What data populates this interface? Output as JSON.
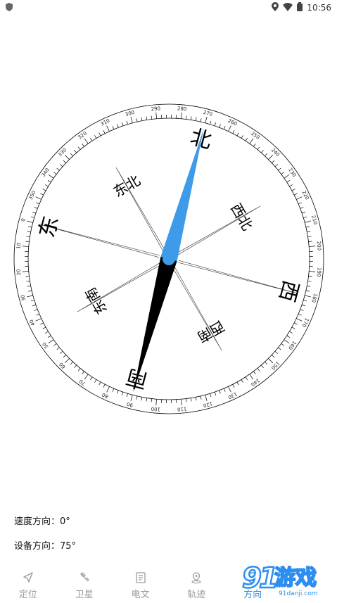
{
  "status_bar": {
    "time": "10:56",
    "icons": [
      "shield-icon",
      "location-icon",
      "wifi-icon",
      "battery-icon"
    ]
  },
  "compass": {
    "heading_degrees": 75,
    "labels": {
      "east": "东",
      "south": "南",
      "west": "西",
      "north": "北",
      "northeast": "东北",
      "southeast": "东南",
      "southwest": "西南",
      "northwest": "西北"
    },
    "needle_colors": {
      "north": "#3d9be9",
      "south": "#000000"
    }
  },
  "readouts": {
    "speed_direction": "速度方向：0°",
    "device_direction": "设备方向：75°"
  },
  "nav": {
    "items": [
      {
        "label": "定位",
        "icon": "navigation-arrow-icon",
        "active": false
      },
      {
        "label": "卫星",
        "icon": "satellite-icon",
        "active": false
      },
      {
        "label": "电文",
        "icon": "document-icon",
        "active": false
      },
      {
        "label": "轨迹",
        "icon": "map-pin-icon",
        "active": false
      },
      {
        "label": "方向",
        "icon": "compass-icon",
        "active": true
      },
      {
        "label": "",
        "icon": "",
        "active": false
      }
    ],
    "accent": "#2d8ef0",
    "inactive": "#9a9a9a"
  },
  "watermark": {
    "text": "游戏",
    "sub": "91danji.com"
  }
}
